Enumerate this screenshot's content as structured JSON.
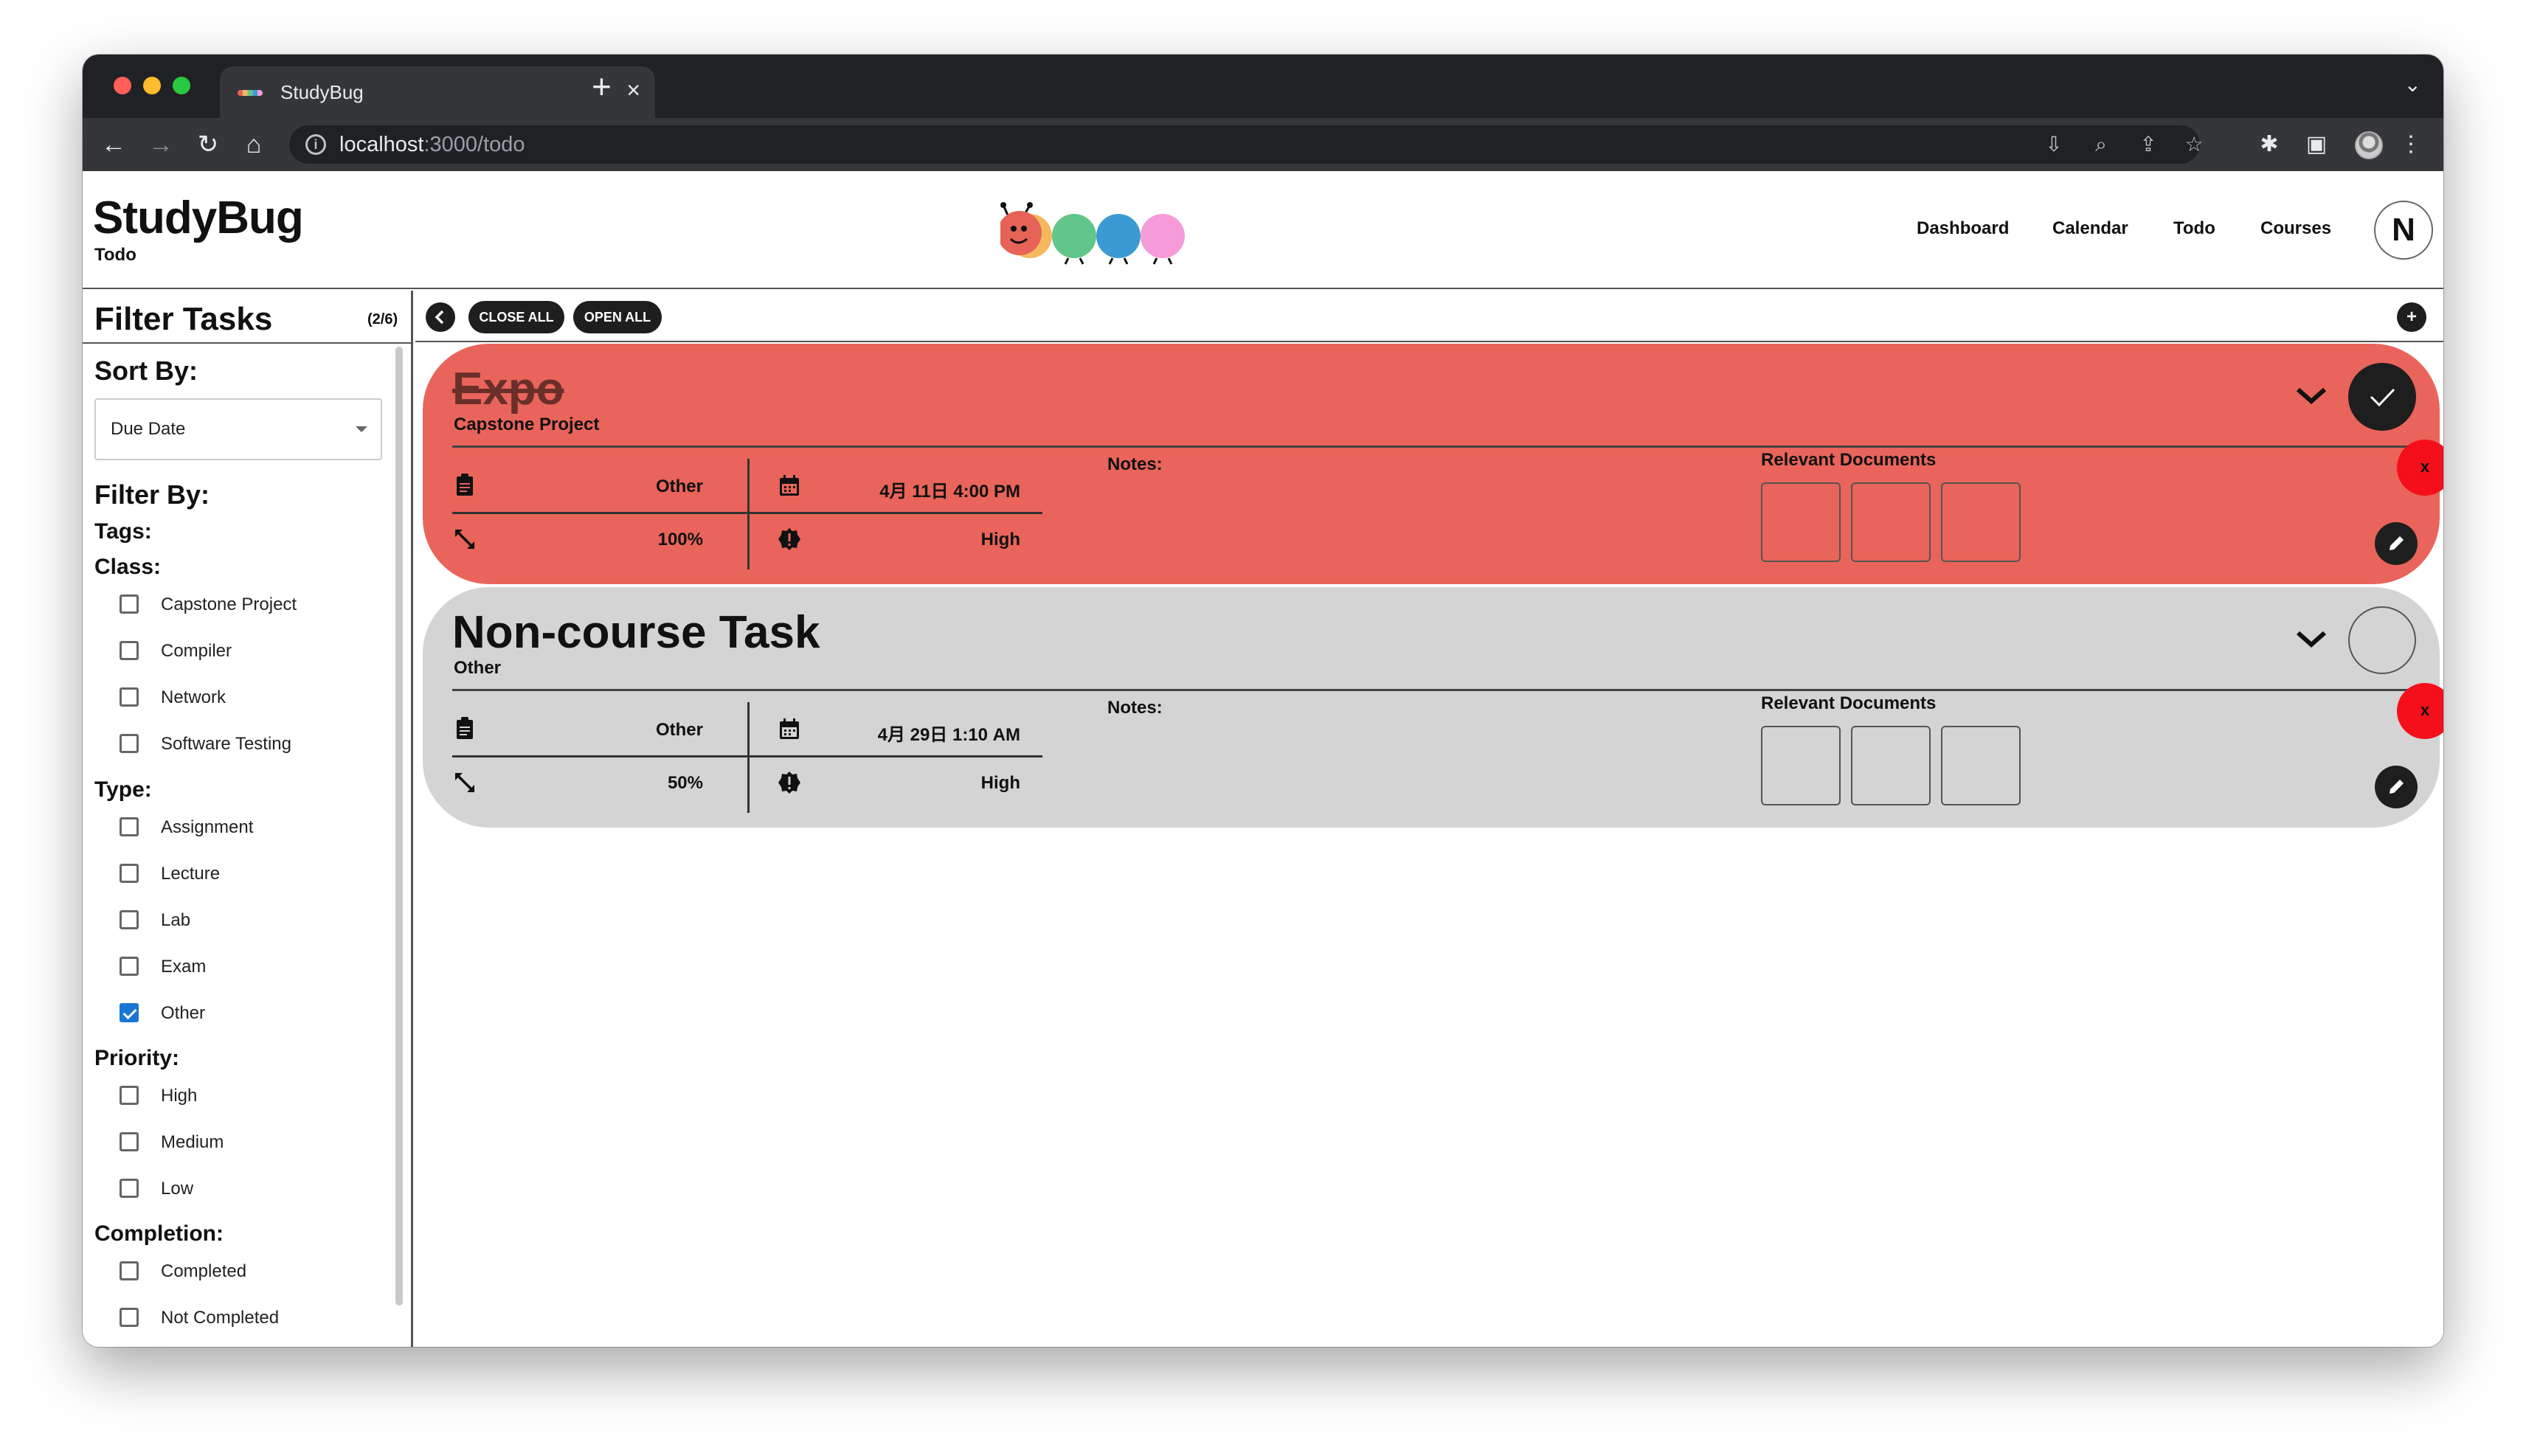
{
  "browser": {
    "tab_title": "StudyBug",
    "tab_close": "×",
    "new_tab": "+",
    "url_host": "localhost",
    "url_path": ":3000/todo"
  },
  "app": {
    "brand": "StudyBug",
    "page_subtitle": "Todo",
    "nav": [
      "Dashboard",
      "Calendar",
      "Todo",
      "Courses"
    ],
    "avatar_initial": "N"
  },
  "sidebar": {
    "title": "Filter Tasks",
    "count": "(2/6)",
    "sort_by_label": "Sort By:",
    "sort_value": "Due Date",
    "filter_by_label": "Filter By:",
    "tags_label": "Tags:",
    "class_label": "Class:",
    "class_options": [
      {
        "label": "Capstone Project",
        "checked": false
      },
      {
        "label": "Compiler",
        "checked": false
      },
      {
        "label": "Network",
        "checked": false
      },
      {
        "label": "Software Testing",
        "checked": false
      }
    ],
    "type_label": "Type:",
    "type_options": [
      {
        "label": "Assignment",
        "checked": false
      },
      {
        "label": "Lecture",
        "checked": false
      },
      {
        "label": "Lab",
        "checked": false
      },
      {
        "label": "Exam",
        "checked": false
      },
      {
        "label": "Other",
        "checked": true
      }
    ],
    "priority_label": "Priority:",
    "priority_options": [
      {
        "label": "High",
        "checked": false
      },
      {
        "label": "Medium",
        "checked": false
      },
      {
        "label": "Low",
        "checked": false
      }
    ],
    "completion_label": "Completion:",
    "completion_options": [
      {
        "label": "Completed",
        "checked": false
      },
      {
        "label": "Not Completed",
        "checked": false
      }
    ]
  },
  "toolbar": {
    "close_all": "CLOSE ALL",
    "open_all": "OPEN ALL",
    "add": "+"
  },
  "tasks": [
    {
      "title": "Expo",
      "course": "Capstone Project",
      "completed": true,
      "color": "#e9645a",
      "type": "Other",
      "due": "4月 11日 4:00 PM",
      "progress": "100%",
      "priority": "High",
      "notes_label": "Notes:",
      "docs_label": "Relevant Documents",
      "delete_label": "x"
    },
    {
      "title": "Non-course Task",
      "course": "Other",
      "completed": false,
      "color": "#d4d4d4",
      "type": "Other",
      "due": "4月 29日 1:10 AM",
      "progress": "50%",
      "priority": "High",
      "notes_label": "Notes:",
      "docs_label": "Relevant Documents",
      "delete_label": "x"
    }
  ],
  "colors": {
    "logo_segments": [
      "#e76257",
      "#f5b85f",
      "#62c58a",
      "#3c9ad3",
      "#f59bd9"
    ],
    "delete_red": "#f40f1a",
    "checkbox_checked": "#1976d2"
  }
}
